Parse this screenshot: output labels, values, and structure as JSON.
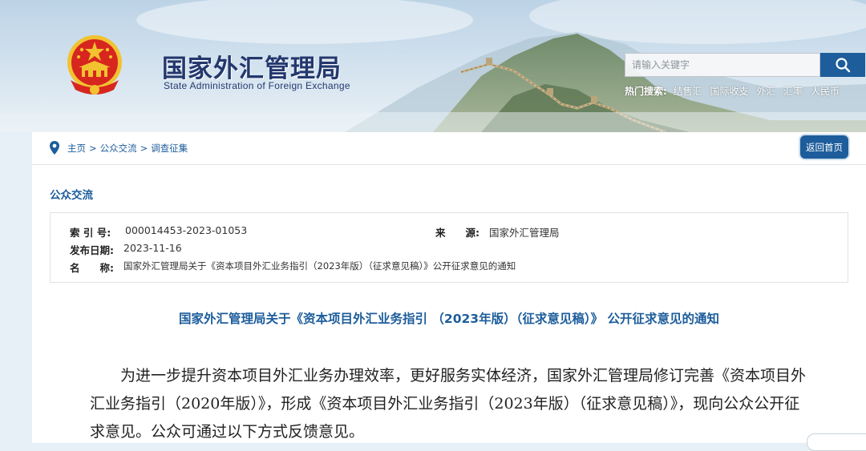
{
  "header": {
    "site_name_cn": "国家外汇管理局",
    "site_name_en": "State Administration of Foreign Exchange",
    "search": {
      "placeholder": "请输入关键字",
      "icon": "search-icon"
    },
    "hot_search": {
      "label": "热门搜索:",
      "items": [
        "结售汇",
        "国际收支",
        "外汇",
        "汇率",
        "人民币"
      ]
    }
  },
  "breadcrumb": {
    "icon": "location-pin-icon",
    "items": [
      "主页",
      "公众交流",
      "调查征集"
    ],
    "separator": ">",
    "home_button": "返回首页"
  },
  "section": {
    "title": "公众交流"
  },
  "meta": {
    "index_label": "索 引 号:",
    "index_value": "000014453-2023-01053",
    "source_label": "来　　源:",
    "source_value": "国家外汇管理局",
    "date_label": "发布日期:",
    "date_value": "2023-11-16",
    "name_label": "名　　称:",
    "name_value": "国家外汇管理局关于《资本项目外汇业务指引（2023年版）（征求意见稿）》公开征求意见的通知"
  },
  "notice": {
    "title": "国家外汇管理局关于《资本项目外汇业务指引 （2023年版）（征求意见稿）》 公开征求意见的通知",
    "body": "为进一步提升资本项目外汇业务办理效率，更好服务实体经济，国家外汇管理局修订完善《资本项目外汇业务指引（2020年版）》，形成《资本项目外汇业务指引（2023年版）（征求意见稿）》，现向公众公开征求意见。公众可通过以下方式反馈意见。"
  },
  "colors": {
    "brand_blue": "#1d5d9b",
    "title_navy": "#24386e",
    "emblem_red": "#d7261e",
    "emblem_gold": "#f2c230"
  }
}
